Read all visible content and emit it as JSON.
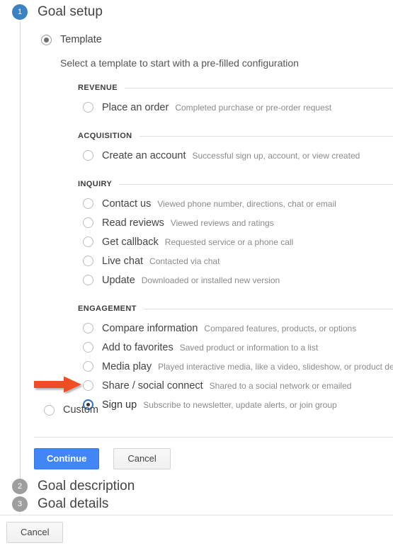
{
  "steps": [
    {
      "number": "1",
      "title": "Goal setup",
      "state": "active"
    },
    {
      "number": "2",
      "title": "Goal description",
      "state": "inactive"
    },
    {
      "number": "3",
      "title": "Goal details",
      "state": "inactive"
    }
  ],
  "goal_setup": {
    "template_option_label": "Template",
    "template_helper_text": "Select a template to start with a pre-filled configuration",
    "custom_option_label": "Custom",
    "sections": [
      {
        "heading": "REVENUE",
        "options": [
          {
            "name": "Place an order",
            "description": "Completed purchase or pre-order request",
            "selected": false
          }
        ]
      },
      {
        "heading": "ACQUISITION",
        "options": [
          {
            "name": "Create an account",
            "description": "Successful sign up, account, or view created",
            "selected": false
          }
        ]
      },
      {
        "heading": "INQUIRY",
        "options": [
          {
            "name": "Contact us",
            "description": "Viewed phone number, directions, chat or email",
            "selected": false
          },
          {
            "name": "Read reviews",
            "description": "Viewed reviews and ratings",
            "selected": false
          },
          {
            "name": "Get callback",
            "description": "Requested service or a phone call",
            "selected": false
          },
          {
            "name": "Live chat",
            "description": "Contacted via chat",
            "selected": false
          },
          {
            "name": "Update",
            "description": "Downloaded or installed new version",
            "selected": false
          }
        ]
      },
      {
        "heading": "ENGAGEMENT",
        "options": [
          {
            "name": "Compare information",
            "description": "Compared features, products, or options",
            "selected": false
          },
          {
            "name": "Add to favorites",
            "description": "Saved product or information to a list",
            "selected": false
          },
          {
            "name": "Media play",
            "description": "Played interactive media, like a video, slideshow, or product demo",
            "selected": false
          },
          {
            "name": "Share / social connect",
            "description": "Shared to a social network or emailed",
            "selected": false
          },
          {
            "name": "Sign up",
            "description": "Subscribe to newsletter, update alerts, or join group",
            "selected": true
          }
        ]
      }
    ]
  },
  "buttons": {
    "continue_label": "Continue",
    "cancel_label": "Cancel",
    "bottom_cancel_label": "Cancel"
  },
  "annotation": {
    "arrow": "red-arrow-icon",
    "points_at": "Sign up"
  },
  "colors": {
    "step_active": "#3b82c4",
    "step_inactive": "#9e9e9e",
    "primary_button": "#4285f4",
    "selected_radio_ring": "#2f6fc0",
    "arrow": "#f04e23",
    "divider": "#e2e2e2"
  }
}
